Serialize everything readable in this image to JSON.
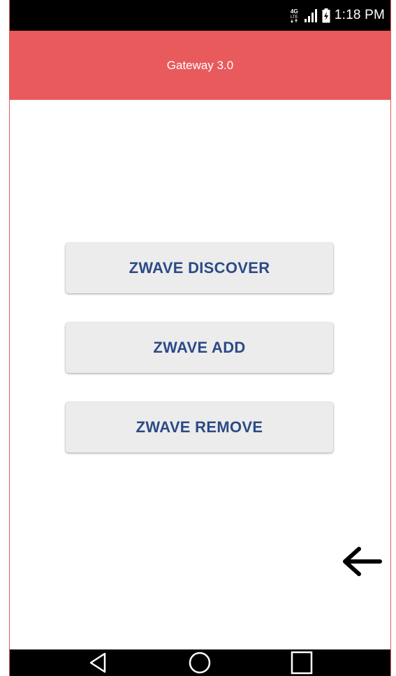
{
  "status_bar": {
    "network_label": "4G LTE",
    "time": "1:18 PM"
  },
  "app_bar": {
    "title": "Gateway 3.0",
    "color": "#e85a5c"
  },
  "buttons": {
    "discover": "ZWAVE DISCOVER",
    "add": "ZWAVE ADD",
    "remove": "ZWAVE REMOVE",
    "text_color": "#2c4a86",
    "background": "#ececec"
  },
  "icons": {
    "back_arrow": "arrow-left-icon",
    "nav_back": "triangle-back-icon",
    "nav_home": "circle-home-icon",
    "nav_recent": "square-recent-icon"
  }
}
